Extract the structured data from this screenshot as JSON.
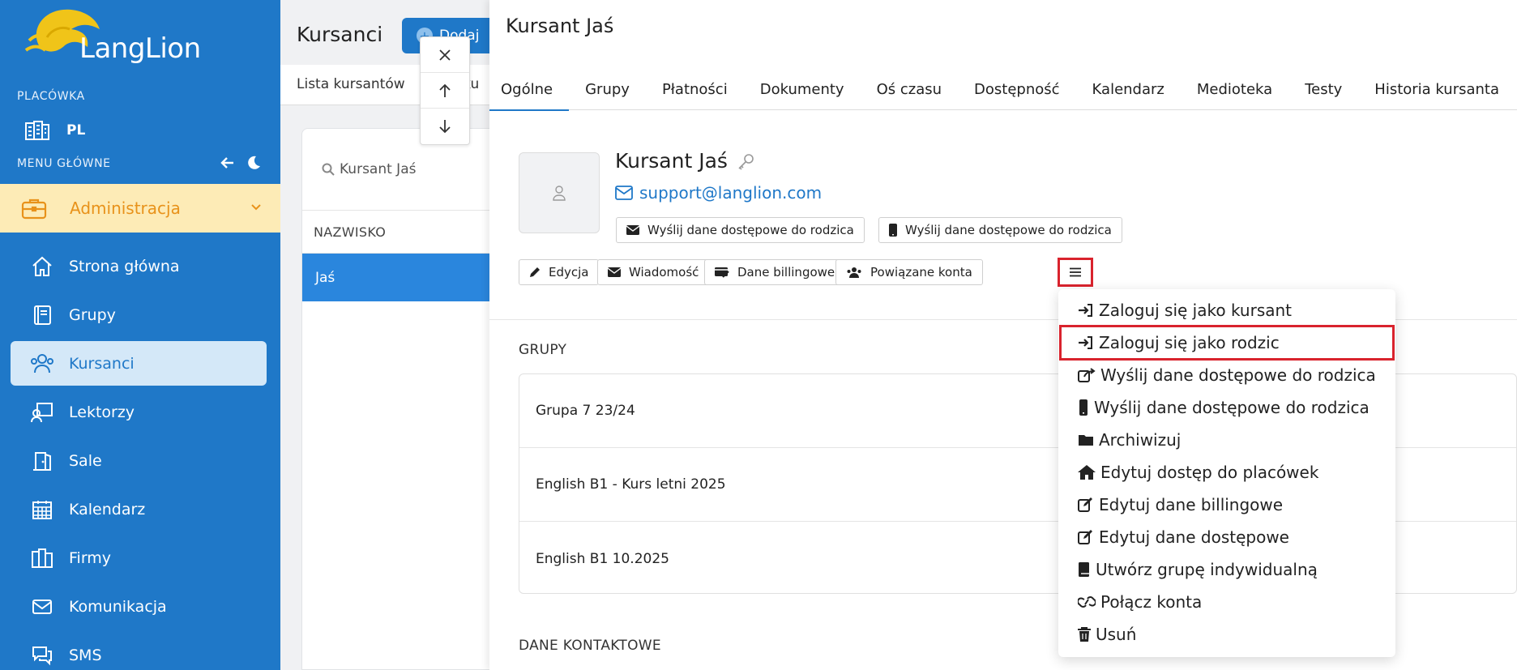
{
  "sidebar": {
    "logo_text": "LangLion",
    "placowka_caption": "PLACÓWKA",
    "placowka_value": "PL",
    "menu_caption": "MENU GŁÓWNE",
    "admin_label": "Administracja",
    "items": [
      {
        "label": "Strona główna",
        "icon": "home-icon"
      },
      {
        "label": "Grupy",
        "icon": "book-icon"
      },
      {
        "label": "Kursanci",
        "icon": "users-icon",
        "active": true
      },
      {
        "label": "Lektorzy",
        "icon": "teacher-icon"
      },
      {
        "label": "Sale",
        "icon": "door-icon"
      },
      {
        "label": "Kalendarz",
        "icon": "calendar-icon"
      },
      {
        "label": "Firmy",
        "icon": "building-icon"
      },
      {
        "label": "Komunikacja",
        "icon": "mail-icon"
      },
      {
        "label": "SMS",
        "icon": "chat-icon"
      }
    ]
  },
  "list": {
    "title": "Kursanci",
    "add_label": "Dodaj",
    "subtab_1": "Lista kursantów",
    "subtab_2": "i ku",
    "search_value": "Kursant Jaś",
    "column_header": "NAZWISKO",
    "rows": [
      "Jaś"
    ]
  },
  "drawer": {
    "title": "Kursant Jaś",
    "tabs": [
      "Ogólne",
      "Grupy",
      "Płatności",
      "Dokumenty",
      "Oś czasu",
      "Dostępność",
      "Kalendarz",
      "Medioteka",
      "Testy",
      "Historia kursanta"
    ],
    "profile": {
      "name": "Kursant Jaś",
      "email": "support@langlion.com",
      "send_email_btn": "Wyślij dane dostępowe do rodzica",
      "send_sms_btn": "Wyślij dane dostępowe do rodzica"
    },
    "actions": {
      "edit": "Edycja",
      "message": "Wiadomość",
      "billing": "Dane billingowe",
      "linked": "Powiązane konta"
    },
    "groups_heading": "GRUPY",
    "groups": [
      "Grupa 7 23/24",
      "English B1 - Kurs letni 2025",
      "English B1 10.2025"
    ],
    "contact_heading": "DANE KONTAKTOWE"
  },
  "dropdown": {
    "items": [
      {
        "label": "Zaloguj się jako kursant",
        "icon": "sign-in-icon"
      },
      {
        "label": "Zaloguj się jako rodzic",
        "icon": "sign-in-icon",
        "highlighted": true
      },
      {
        "label": "Wyślij dane dostępowe do rodzica",
        "icon": "share-icon"
      },
      {
        "label": "Wyślij dane dostępowe do rodzica",
        "icon": "mobile-icon"
      },
      {
        "label": "Archiwizuj",
        "icon": "folder-icon"
      },
      {
        "label": "Edytuj dostęp do placówek",
        "icon": "home-icon"
      },
      {
        "label": "Edytuj dane billingowe",
        "icon": "edit-icon"
      },
      {
        "label": "Edytuj dane dostępowe",
        "icon": "edit-icon"
      },
      {
        "label": "Utwórz grupę indywidualną",
        "icon": "book-icon"
      },
      {
        "label": "Połącz konta",
        "icon": "link-icon"
      },
      {
        "label": "Usuń",
        "icon": "trash-icon"
      }
    ]
  },
  "colors": {
    "primary": "#1f78c8",
    "admin_bg": "#fdebb6",
    "admin_fg": "#e8921a",
    "highlight": "#d9232d"
  }
}
